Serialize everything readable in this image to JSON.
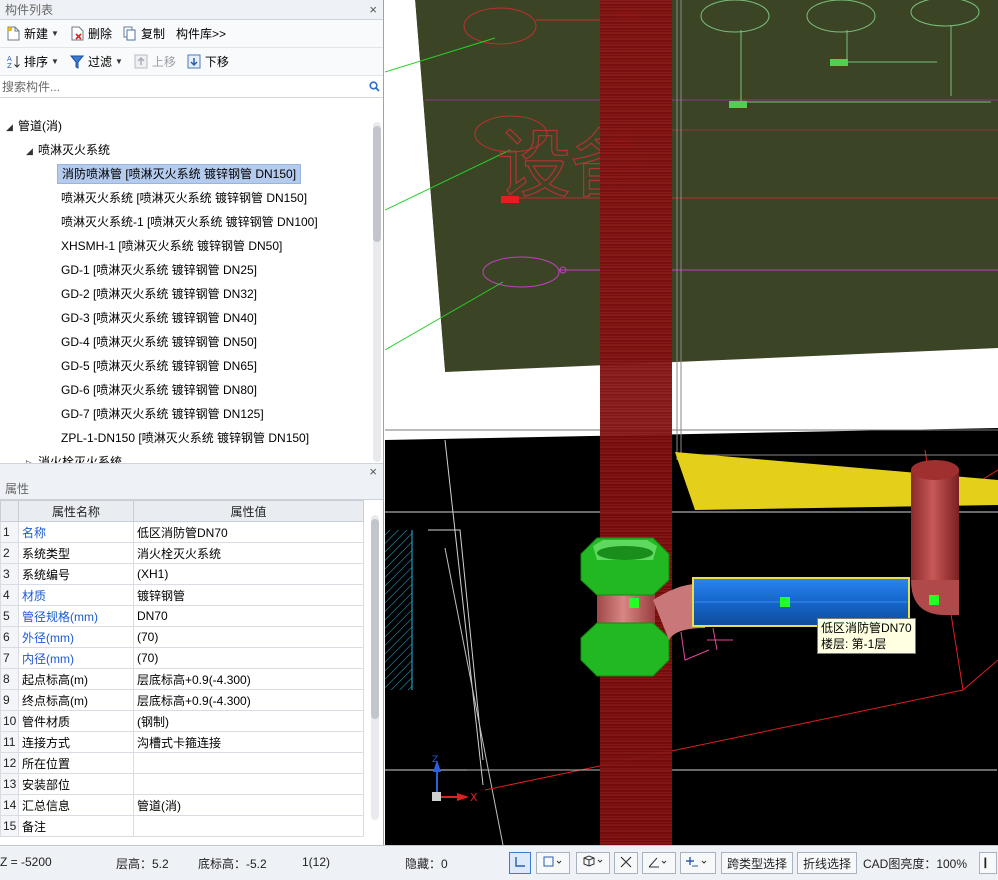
{
  "component_list": {
    "title": "构件列表",
    "toolbar": [
      {
        "id": "new",
        "label": "新建",
        "icon": "new-doc-icon",
        "dropdown": true
      },
      {
        "id": "delete",
        "label": "删除",
        "icon": "delete-doc-icon"
      },
      {
        "id": "copy",
        "label": "复制",
        "icon": "copy-icon"
      },
      {
        "id": "library",
        "label": "构件库>>"
      }
    ],
    "toolbar2": [
      {
        "id": "sort",
        "label": "排序",
        "icon": "sort-icon",
        "dropdown": true
      },
      {
        "id": "filter",
        "label": "过滤",
        "icon": "filter-icon",
        "dropdown": true
      },
      {
        "id": "move_up",
        "label": "上移",
        "icon": "arrow-up-icon",
        "disabled": true
      },
      {
        "id": "move_down",
        "label": "下移",
        "icon": "arrow-down-icon"
      }
    ],
    "search_placeholder": "搜索构件...",
    "tree": {
      "root": "管道(消)",
      "group": "喷淋灭火系统",
      "items": [
        "消防喷淋管 [喷淋灭火系统 镀锌钢管 DN150]",
        "喷淋灭火系统 [喷淋灭火系统 镀锌钢管 DN150]",
        "喷淋灭火系统-1 [喷淋灭火系统 镀锌钢管 DN100]",
        "XHSMH-1 [喷淋灭火系统 镀锌钢管 DN50]",
        "GD-1 [喷淋灭火系统 镀锌钢管 DN25]",
        "GD-2 [喷淋灭火系统 镀锌钢管 DN32]",
        "GD-3 [喷淋灭火系统 镀锌钢管 DN40]",
        "GD-4 [喷淋灭火系统 镀锌钢管 DN50]",
        "GD-5 [喷淋灭火系统 镀锌钢管 DN65]",
        "GD-6 [喷淋灭火系统 镀锌钢管 DN80]",
        "GD-7 [喷淋灭火系统 镀锌钢管 DN125]",
        "ZPL-1-DN150 [喷淋灭火系统 镀锌钢管 DN150]"
      ],
      "selected_index": 0,
      "next_group_partial": "消火栓灭火系统"
    }
  },
  "properties": {
    "title": "属性",
    "col_name": "属性名称",
    "col_value": "属性值",
    "rows": [
      {
        "n": "1",
        "name": "名称",
        "value": "低区消防管DN70",
        "blue": true
      },
      {
        "n": "2",
        "name": "系统类型",
        "value": "消火栓灭火系统",
        "blue": false
      },
      {
        "n": "3",
        "name": "系统编号",
        "value": "(XH1)",
        "blue": false
      },
      {
        "n": "4",
        "name": "材质",
        "value": "镀锌钢管",
        "blue": true
      },
      {
        "n": "5",
        "name": "管径规格(mm)",
        "value": "DN70",
        "blue": true
      },
      {
        "n": "6",
        "name": "外径(mm)",
        "value": "(70)",
        "blue": true
      },
      {
        "n": "7",
        "name": "内径(mm)",
        "value": "(70)",
        "blue": true
      },
      {
        "n": "8",
        "name": "起点标高(m)",
        "value": "层底标高+0.9(-4.300)",
        "blue": false
      },
      {
        "n": "9",
        "name": "终点标高(m)",
        "value": "层底标高+0.9(-4.300)",
        "blue": false
      },
      {
        "n": "10",
        "name": "管件材质",
        "value": "(钢制)",
        "blue": false
      },
      {
        "n": "11",
        "name": "连接方式",
        "value": "沟槽式卡箍连接",
        "blue": false
      },
      {
        "n": "12",
        "name": "所在位置",
        "value": "",
        "blue": false
      },
      {
        "n": "13",
        "name": "安装部位",
        "value": "",
        "blue": false
      },
      {
        "n": "14",
        "name": "汇总信息",
        "value": "管道(消)",
        "blue": false
      },
      {
        "n": "15",
        "name": "备注",
        "value": "",
        "blue": false
      }
    ]
  },
  "viewport": {
    "tooltip_line1": "低区消防管DN70",
    "tooltip_line2": "楼层: 第-1层",
    "cad_text": "设备",
    "axis_x": "X",
    "axis_z": "Z"
  },
  "status_bar": {
    "z": "Z = -5200",
    "floor_height": "层高：5.2",
    "bottom_elev": "底标高：-5.2",
    "count": "1(12)",
    "hidden": "隐藏：0",
    "cross_type_select": "跨类型选择",
    "polyline_select": "折线选择",
    "cad_brightness": "CAD图亮度：100%"
  },
  "colors": {
    "accent_blue": "#1a5ad4",
    "selection": "#b4cbee",
    "pipe_blue": "#1e78e8",
    "fitting_green": "#1fb81f",
    "pipe_red": "#c86e6e"
  }
}
